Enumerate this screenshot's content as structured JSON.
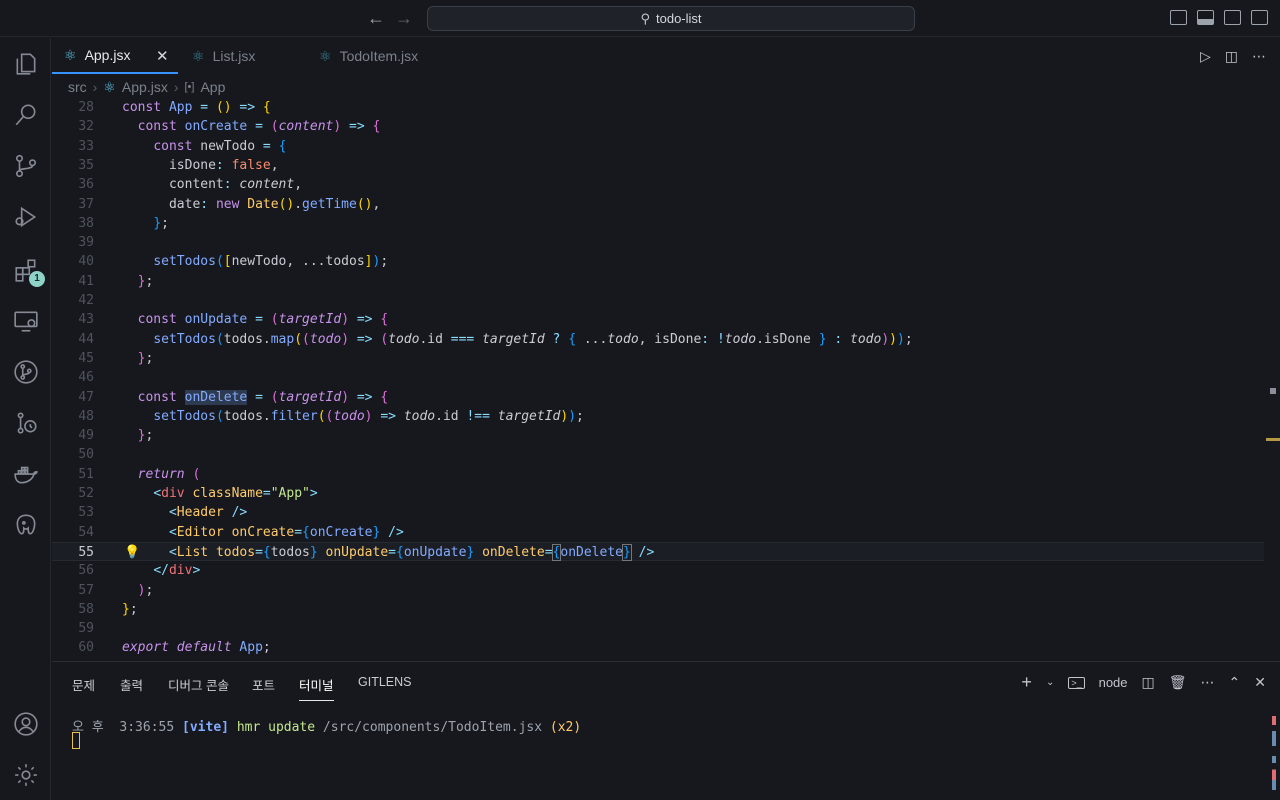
{
  "window": {
    "search_text": "todo-list"
  },
  "tabs": [
    {
      "label": "App.jsx",
      "active": true
    },
    {
      "label": "List.jsx",
      "active": false
    },
    {
      "label": "TodoItem.jsx",
      "active": false
    }
  ],
  "breadcrumb": {
    "folder": "src",
    "file": "App.jsx",
    "symbol": "App"
  },
  "activity": {
    "extensions_badge": "1"
  },
  "editor": {
    "current_line": "55",
    "line_numbers": [
      "28",
      "32",
      "33",
      "35",
      "36",
      "37",
      "38",
      "39",
      "40",
      "41",
      "42",
      "43",
      "44",
      "45",
      "46",
      "47",
      "48",
      "49",
      "50",
      "51",
      "52",
      "53",
      "54",
      "55",
      "56",
      "57",
      "58",
      "59",
      "60"
    ]
  },
  "panel": {
    "tabs": [
      "문제",
      "출력",
      "디버그 콘솔",
      "포트",
      "터미널",
      "GITLENS"
    ],
    "active_tab": "터미널",
    "terminal_name": "node",
    "terminal_time": "오 후  3:36:55",
    "terminal_tag": "[vite]",
    "terminal_msg": "hmr update",
    "terminal_path": "/src/components/TodoItem.jsx",
    "terminal_count": "(x2)"
  },
  "colors": {
    "accent": "#3794ff",
    "background": "#16181d",
    "badge": "#8fd3c8"
  }
}
